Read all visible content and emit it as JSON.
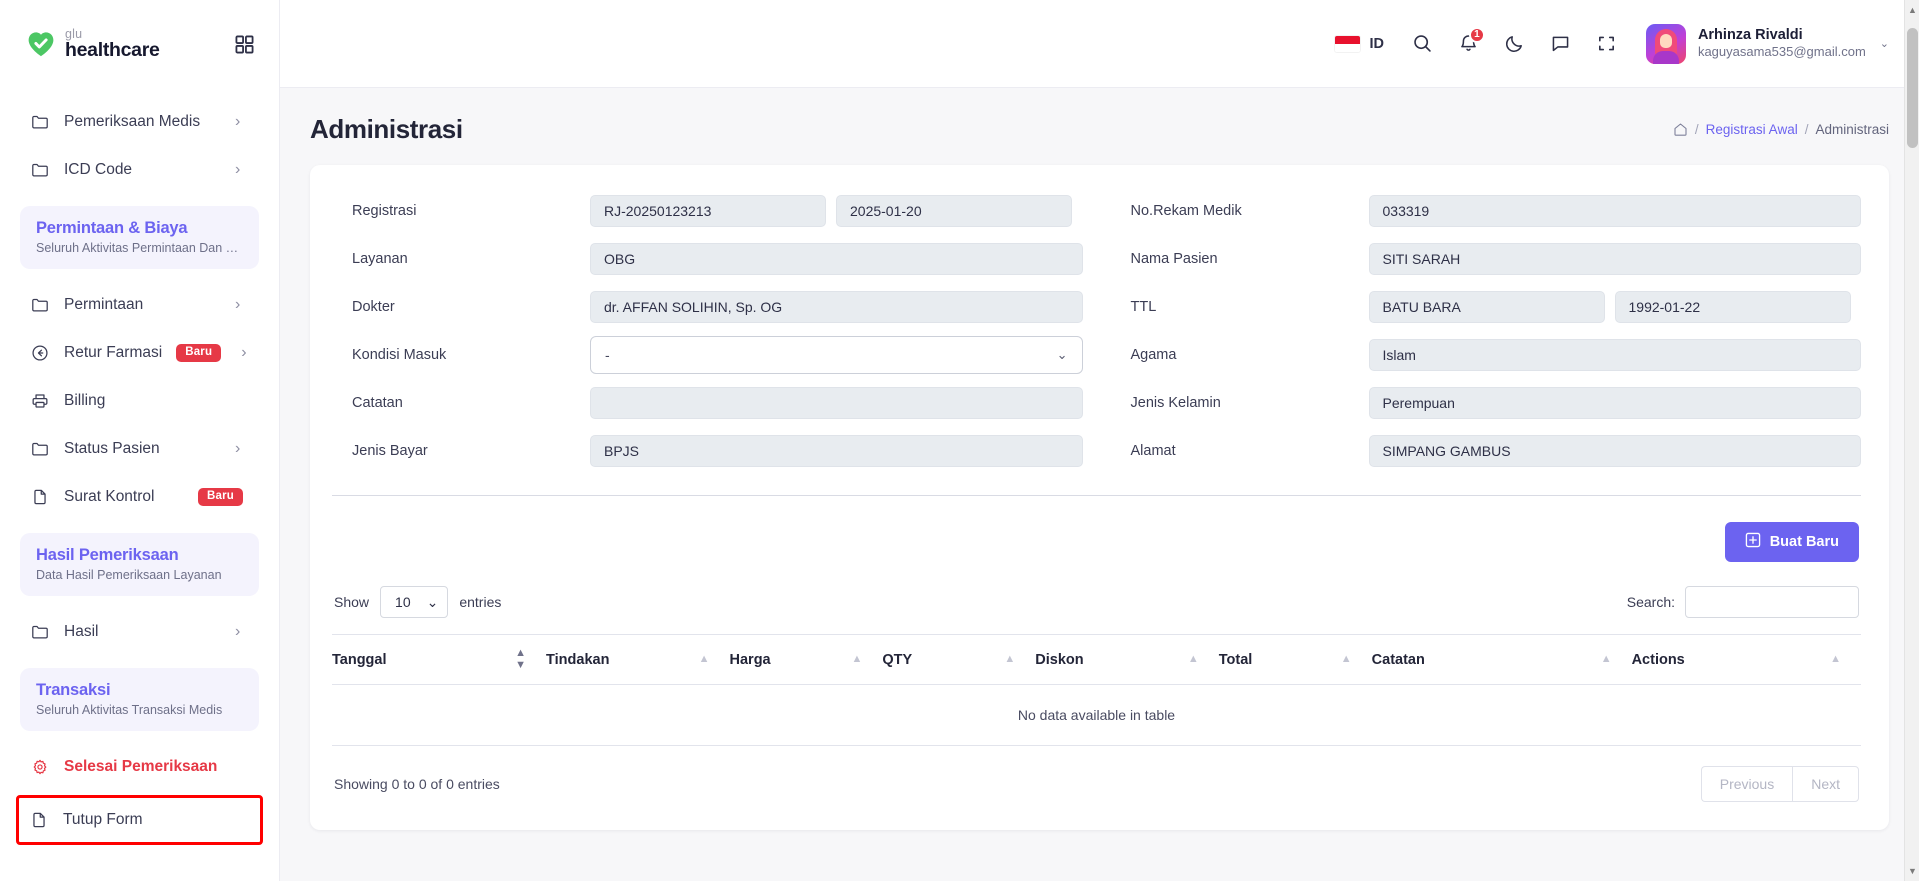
{
  "brand": {
    "top": "glu",
    "bottom": "healthcare",
    "logo_icon": "heart-check-icon",
    "grid_icon": "grid-apps-icon"
  },
  "sidebar": {
    "items": [
      {
        "type": "link",
        "label": "Pemeriksaan Medis",
        "icon": "folder-icon",
        "chevron": "›",
        "badge": ""
      },
      {
        "type": "link",
        "label": "ICD Code",
        "icon": "folder-icon",
        "chevron": "›",
        "badge": ""
      },
      {
        "type": "section",
        "title": "Permintaan & Biaya",
        "subtitle": "Seluruh Aktivitas Permintaan Dan …"
      },
      {
        "type": "link",
        "label": "Permintaan",
        "icon": "folder-icon",
        "chevron": "›",
        "badge": ""
      },
      {
        "type": "link",
        "label": "Retur Farmasi",
        "icon": "arrow-circle-left-icon",
        "chevron": "›",
        "badge": "Baru"
      },
      {
        "type": "link",
        "label": "Billing",
        "icon": "printer-icon",
        "chevron": "",
        "badge": ""
      },
      {
        "type": "link",
        "label": "Status Pasien",
        "icon": "folder-icon",
        "chevron": "›",
        "badge": ""
      },
      {
        "type": "link",
        "label": "Surat Kontrol",
        "icon": "file-icon",
        "chevron": "",
        "badge": "Baru"
      },
      {
        "type": "section",
        "title": "Hasil Pemeriksaan",
        "subtitle": "Data Hasil Pemeriksaan Layanan"
      },
      {
        "type": "link",
        "label": "Hasil",
        "icon": "folder-icon",
        "chevron": "›",
        "badge": ""
      },
      {
        "type": "section",
        "title": "Transaksi",
        "subtitle": "Seluruh Aktivitas Transaksi Medis"
      },
      {
        "type": "danger",
        "label": "Selesai Pemeriksaan",
        "icon": "gear-icon",
        "chevron": "",
        "badge": ""
      },
      {
        "type": "highlighted",
        "label": "Tutup Form",
        "icon": "file-icon",
        "chevron": "",
        "badge": ""
      }
    ]
  },
  "topbar": {
    "language_code": "ID",
    "flag": "indonesia-flag",
    "search_icon": "search-icon",
    "notification_icon": "bell-icon",
    "notification_count": "1",
    "theme_icon": "moon-icon",
    "chat_icon": "chat-bubble-icon",
    "fullscreen_icon": "fullscreen-icon",
    "user_name": "Arhinza Rivaldi",
    "user_email": "kaguyasama535@gmail.com",
    "user_chevron": "⌄"
  },
  "page": {
    "title": "Administrasi",
    "breadcrumb": {
      "home_icon": "home-icon",
      "sep": "/",
      "link": "Registrasi Awal",
      "current": "Administrasi"
    }
  },
  "form": {
    "left": [
      {
        "label": "Registrasi",
        "value": "RJ-20250123213",
        "value2": "2025-01-20",
        "kind": "split"
      },
      {
        "label": "Layanan",
        "value": "OBG",
        "kind": "text"
      },
      {
        "label": "Dokter",
        "value": "dr. AFFAN SOLIHIN, Sp. OG",
        "kind": "text"
      },
      {
        "label": "Kondisi Masuk",
        "value": "-",
        "kind": "select",
        "chevron": "⌄"
      },
      {
        "label": "Catatan",
        "value": "",
        "kind": "text"
      },
      {
        "label": "Jenis Bayar",
        "value": "BPJS",
        "kind": "text"
      }
    ],
    "right": [
      {
        "label": "No.Rekam Medik",
        "value": "033319",
        "kind": "text"
      },
      {
        "label": "Nama Pasien",
        "value": "SITI SARAH",
        "kind": "text"
      },
      {
        "label": "TTL",
        "value": "BATU BARA",
        "value2": "1992-01-22",
        "kind": "split"
      },
      {
        "label": "Agama",
        "value": "Islam",
        "kind": "text"
      },
      {
        "label": "Jenis Kelamin",
        "value": "Perempuan",
        "kind": "text"
      },
      {
        "label": "Alamat",
        "value": "SIMPANG GAMBUS",
        "kind": "text"
      }
    ]
  },
  "actions": {
    "create_label": "Buat Baru",
    "create_icon": "plus-square-icon"
  },
  "table": {
    "show_label": "Show",
    "entries_label": "entries",
    "page_length": "10",
    "length_chevron": "⌄",
    "search_label": "Search:",
    "search_value": "",
    "columns": [
      "Tanggal",
      "Tindakan",
      "Harga",
      "QTY",
      "Diskon",
      "Total",
      "Catatan",
      "Actions"
    ],
    "empty_message": "No data available in table",
    "info": "Showing 0 to 0 of 0 entries",
    "previous_label": "Previous",
    "next_label": "Next"
  },
  "colors": {
    "accent": "#6c63f0",
    "danger": "#e63946",
    "highlight_border": "#ff0000",
    "field_bg": "#e8ecf0",
    "section_bg": "#f4f3fd"
  }
}
